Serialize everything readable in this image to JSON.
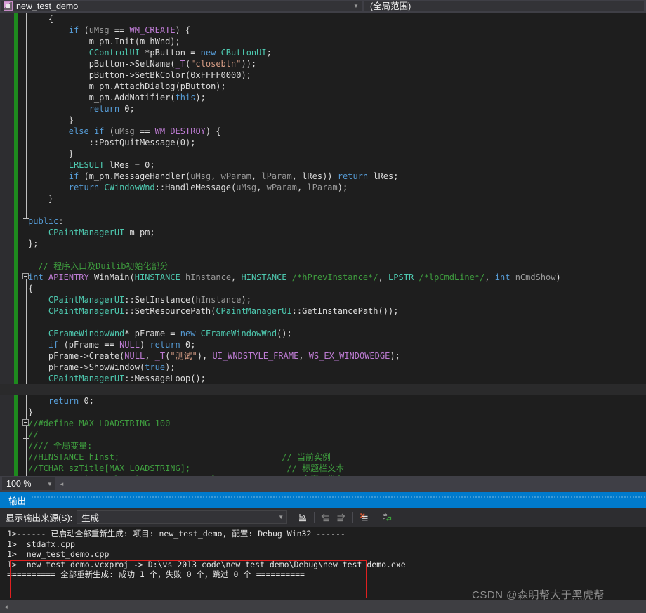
{
  "topbar": {
    "nav_left": {
      "value": "new_test_demo",
      "icon": "class-selector-icon",
      "caret": "▼"
    },
    "nav_right": {
      "value": "(全局范围)",
      "caret": "▼"
    }
  },
  "editor": {
    "zoom_level": "100 %",
    "caret_glyph": "◂",
    "lines": [
      [
        {
          "t": "    {",
          "c": "pln"
        }
      ],
      [
        {
          "t": "        ",
          "c": "pln"
        },
        {
          "t": "if",
          "c": "kw"
        },
        {
          "t": " (",
          "c": "pln"
        },
        {
          "t": "uMsg",
          "c": "par"
        },
        {
          "t": " == ",
          "c": "pln"
        },
        {
          "t": "WM_CREATE",
          "c": "mac"
        },
        {
          "t": ") {",
          "c": "pln"
        }
      ],
      [
        {
          "t": "            m_pm.Init(m_hWnd);",
          "c": "pln"
        }
      ],
      [
        {
          "t": "            ",
          "c": "pln"
        },
        {
          "t": "CControlUI",
          "c": "typ"
        },
        {
          "t": " *pButton = ",
          "c": "pln"
        },
        {
          "t": "new",
          "c": "kw"
        },
        {
          "t": " ",
          "c": "pln"
        },
        {
          "t": "CButtonUI",
          "c": "typ"
        },
        {
          "t": ";",
          "c": "pln"
        }
      ],
      [
        {
          "t": "            pButton->SetName(",
          "c": "pln"
        },
        {
          "t": "_T",
          "c": "mac"
        },
        {
          "t": "(",
          "c": "pln"
        },
        {
          "t": "\"closebtn\"",
          "c": "str"
        },
        {
          "t": "));",
          "c": "pln"
        }
      ],
      [
        {
          "t": "            pButton->SetBkColor(",
          "c": "pln"
        },
        {
          "t": "0xFFFF0000",
          "c": "pln"
        },
        {
          "t": ");",
          "c": "pln"
        }
      ],
      [
        {
          "t": "            m_pm.AttachDialog(pButton);",
          "c": "pln"
        }
      ],
      [
        {
          "t": "            m_pm.AddNotifier(",
          "c": "pln"
        },
        {
          "t": "this",
          "c": "kw"
        },
        {
          "t": ");",
          "c": "pln"
        }
      ],
      [
        {
          "t": "            ",
          "c": "pln"
        },
        {
          "t": "return",
          "c": "kw"
        },
        {
          "t": " 0;",
          "c": "pln"
        }
      ],
      [
        {
          "t": "        }",
          "c": "pln"
        }
      ],
      [
        {
          "t": "        ",
          "c": "pln"
        },
        {
          "t": "else",
          "c": "kw"
        },
        {
          "t": " ",
          "c": "pln"
        },
        {
          "t": "if",
          "c": "kw"
        },
        {
          "t": " (",
          "c": "pln"
        },
        {
          "t": "uMsg",
          "c": "par"
        },
        {
          "t": " == ",
          "c": "pln"
        },
        {
          "t": "WM_DESTROY",
          "c": "mac"
        },
        {
          "t": ") {",
          "c": "pln"
        }
      ],
      [
        {
          "t": "            ::PostQuitMessage(0);",
          "c": "pln"
        }
      ],
      [
        {
          "t": "        }",
          "c": "pln"
        }
      ],
      [
        {
          "t": "        ",
          "c": "pln"
        },
        {
          "t": "LRESULT",
          "c": "typ"
        },
        {
          "t": " lRes = 0;",
          "c": "pln"
        }
      ],
      [
        {
          "t": "        ",
          "c": "pln"
        },
        {
          "t": "if",
          "c": "kw"
        },
        {
          "t": " (m_pm.MessageHandler(",
          "c": "pln"
        },
        {
          "t": "uMsg",
          "c": "par"
        },
        {
          "t": ", ",
          "c": "pln"
        },
        {
          "t": "wParam",
          "c": "par"
        },
        {
          "t": ", ",
          "c": "pln"
        },
        {
          "t": "lParam",
          "c": "par"
        },
        {
          "t": ", lRes)) ",
          "c": "pln"
        },
        {
          "t": "return",
          "c": "kw"
        },
        {
          "t": " lRes;",
          "c": "pln"
        }
      ],
      [
        {
          "t": "        ",
          "c": "pln"
        },
        {
          "t": "return",
          "c": "kw"
        },
        {
          "t": " ",
          "c": "pln"
        },
        {
          "t": "CWindowWnd",
          "c": "typ"
        },
        {
          "t": "::HandleMessage(",
          "c": "pln"
        },
        {
          "t": "uMsg",
          "c": "par"
        },
        {
          "t": ", ",
          "c": "pln"
        },
        {
          "t": "wParam",
          "c": "par"
        },
        {
          "t": ", ",
          "c": "pln"
        },
        {
          "t": "lParam",
          "c": "par"
        },
        {
          "t": ");",
          "c": "pln"
        }
      ],
      [
        {
          "t": "    }",
          "c": "pln"
        }
      ],
      [
        {
          "t": "",
          "c": "pln"
        }
      ],
      [
        {
          "t": "",
          "c": "pln"
        },
        {
          "t": "public",
          "c": "kw"
        },
        {
          "t": ":",
          "c": "pln"
        }
      ],
      [
        {
          "t": "    ",
          "c": "pln"
        },
        {
          "t": "CPaintManagerUI",
          "c": "typ"
        },
        {
          "t": " m_pm;",
          "c": "pln"
        }
      ],
      [
        {
          "t": "};",
          "c": "pln"
        }
      ],
      [
        {
          "t": "",
          "c": "pln"
        }
      ],
      [
        {
          "t": "  // 程序入口及Duilib初始化部分",
          "c": "com"
        }
      ],
      [
        {
          "t": "",
          "c": "pln"
        },
        {
          "t": "int",
          "c": "kw"
        },
        {
          "t": " ",
          "c": "pln"
        },
        {
          "t": "APIENTRY",
          "c": "mac"
        },
        {
          "t": " WinMain(",
          "c": "pln"
        },
        {
          "t": "HINSTANCE",
          "c": "typ"
        },
        {
          "t": " ",
          "c": "pln"
        },
        {
          "t": "hInstance",
          "c": "par"
        },
        {
          "t": ", ",
          "c": "pln"
        },
        {
          "t": "HINSTANCE",
          "c": "typ"
        },
        {
          "t": " ",
          "c": "pln"
        },
        {
          "t": "/*hPrevInstance*/",
          "c": "com"
        },
        {
          "t": ", ",
          "c": "pln"
        },
        {
          "t": "LPSTR",
          "c": "typ"
        },
        {
          "t": " ",
          "c": "pln"
        },
        {
          "t": "/*lpCmdLine*/",
          "c": "com"
        },
        {
          "t": ", ",
          "c": "pln"
        },
        {
          "t": "int",
          "c": "kw"
        },
        {
          "t": " ",
          "c": "pln"
        },
        {
          "t": "nCmdShow",
          "c": "par"
        },
        {
          "t": ")",
          "c": "pln"
        }
      ],
      [
        {
          "t": "{",
          "c": "pln"
        }
      ],
      [
        {
          "t": "    ",
          "c": "pln"
        },
        {
          "t": "CPaintManagerUI",
          "c": "typ"
        },
        {
          "t": "::SetInstance(",
          "c": "pln"
        },
        {
          "t": "hInstance",
          "c": "par"
        },
        {
          "t": ");",
          "c": "pln"
        }
      ],
      [
        {
          "t": "    ",
          "c": "pln"
        },
        {
          "t": "CPaintManagerUI",
          "c": "typ"
        },
        {
          "t": "::SetResourcePath(",
          "c": "pln"
        },
        {
          "t": "CPaintManagerUI",
          "c": "typ"
        },
        {
          "t": "::GetInstancePath());",
          "c": "pln"
        }
      ],
      [
        {
          "t": "",
          "c": "pln"
        }
      ],
      [
        {
          "t": "    ",
          "c": "pln"
        },
        {
          "t": "CFrameWindowWnd",
          "c": "typ"
        },
        {
          "t": "* pFrame = ",
          "c": "pln"
        },
        {
          "t": "new",
          "c": "kw"
        },
        {
          "t": " ",
          "c": "pln"
        },
        {
          "t": "CFrameWindowWnd",
          "c": "typ"
        },
        {
          "t": "();",
          "c": "pln"
        }
      ],
      [
        {
          "t": "    ",
          "c": "pln"
        },
        {
          "t": "if",
          "c": "kw"
        },
        {
          "t": " (pFrame == ",
          "c": "pln"
        },
        {
          "t": "NULL",
          "c": "mac"
        },
        {
          "t": ") ",
          "c": "pln"
        },
        {
          "t": "return",
          "c": "kw"
        },
        {
          "t": " 0;",
          "c": "pln"
        }
      ],
      [
        {
          "t": "    pFrame->Create(",
          "c": "pln"
        },
        {
          "t": "NULL",
          "c": "mac"
        },
        {
          "t": ", ",
          "c": "pln"
        },
        {
          "t": "_T",
          "c": "mac"
        },
        {
          "t": "(",
          "c": "pln"
        },
        {
          "t": "\"测试\"",
          "c": "str"
        },
        {
          "t": "), ",
          "c": "pln"
        },
        {
          "t": "UI_WNDSTYLE_FRAME",
          "c": "mac"
        },
        {
          "t": ", ",
          "c": "pln"
        },
        {
          "t": "WS_EX_WINDOWEDGE",
          "c": "mac"
        },
        {
          "t": ");",
          "c": "pln"
        }
      ],
      [
        {
          "t": "    pFrame->ShowWindow(",
          "c": "pln"
        },
        {
          "t": "true",
          "c": "kw"
        },
        {
          "t": ");",
          "c": "pln"
        }
      ],
      [
        {
          "t": "    ",
          "c": "pln"
        },
        {
          "t": "CPaintManagerUI",
          "c": "typ"
        },
        {
          "t": "::MessageLoop();",
          "c": "pln"
        }
      ],
      [
        {
          "t": "",
          "c": "pln"
        }
      ],
      [
        {
          "t": "    ",
          "c": "pln"
        },
        {
          "t": "return",
          "c": "kw"
        },
        {
          "t": " 0;",
          "c": "pln"
        }
      ],
      [
        {
          "t": "}",
          "c": "pln"
        }
      ],
      [
        {
          "t": "//#define MAX_LOADSTRING 100",
          "c": "com"
        }
      ],
      [
        {
          "t": "//",
          "c": "com"
        }
      ],
      [
        {
          "t": "//// 全局变量:",
          "c": "com"
        }
      ],
      [
        {
          "t": "//HINSTANCE hInst;                                // 当前实例",
          "c": "com"
        }
      ],
      [
        {
          "t": "//TCHAR szTitle[MAX_LOADSTRING];                   // 标题栏文本",
          "c": "com"
        }
      ],
      [
        {
          "t": "//TCHAR szWindowClass[MAX_LOADSTRING];             // 主窗口类名",
          "c": "com"
        }
      ]
    ],
    "current_line_index": 33
  },
  "output": {
    "title": "输出",
    "source_label_pre": "显示输出来源(",
    "source_label_key": "S",
    "source_label_post": "):",
    "source_value": "生成",
    "caret": "▼",
    "toolbar_icons": [
      "jump-to-source-icon",
      "previous-message-icon",
      "next-message-icon",
      "clear-all-icon",
      "toggle-word-wrap-icon"
    ],
    "lines": [
      "1>------ 已启动全部重新生成: 项目: new_test_demo, 配置: Debug Win32 ------",
      "1>  stdafx.cpp",
      "1>  new_test_demo.cpp",
      "1>  new_test_demo.vcxproj -> D:\\vs_2013_code\\new_test_demo\\Debug\\new_test_demo.exe",
      "========== 全部重新生成: 成功 1 个，失败 0 个，跳过 0 个 =========="
    ],
    "highlight_color": "#e02020",
    "scroll_arrow": "◂"
  },
  "watermark": {
    "text": "CSDN @森明帮大于黑虎帮"
  },
  "colors": {
    "accent_blue": "#007acc",
    "change_bar_green": "#1e8a1e",
    "editor_bg": "#1e1e1e",
    "chrome_bg": "#2d2d30"
  }
}
